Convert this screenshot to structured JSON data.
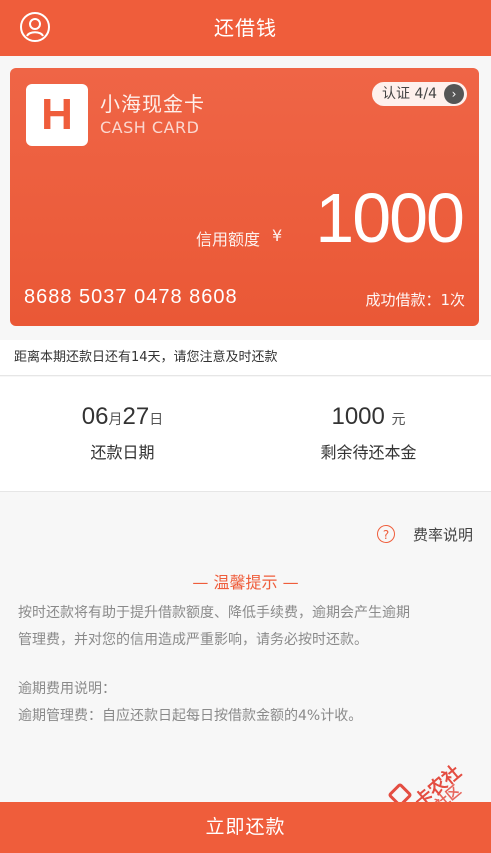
{
  "header": {
    "title": "还借钱",
    "profile_icon": "user-icon"
  },
  "card": {
    "logo_letter": "H",
    "name": "小海现金卡",
    "sub": "CASH CARD",
    "auth_label": "认证",
    "auth_progress": "4/4",
    "limit_label": "信用额度",
    "currency": "¥",
    "limit_value": "1000",
    "card_number": "8688 5037 0478 8608",
    "success_loans": "成功借款：1次"
  },
  "notice": "距离本期还款日还有14天，请您注意及时还款",
  "stats": {
    "due_month": "06",
    "month_unit": "月",
    "due_day": "27",
    "day_unit": "日",
    "due_label": "还款日期",
    "principal_value": "1000",
    "principal_unit": "元",
    "principal_label": "剩余待还本金"
  },
  "rate_link": "费率说明",
  "tip": {
    "title": "— 温馨提示 —",
    "line1": "按时还款将有助于提升借款额度、降低手续费，逾期会产生逾期",
    "line2": "管理费，并对您的信用造成严重影响，请务必按时还款。",
    "overdue_title": "逾期费用说明：",
    "overdue_text": "逾期管理费：自应还款日起每日按借款金额的4%计收。"
  },
  "footer_button": "立即还款",
  "watermark": {
    "line1": "卡农社区",
    "line2": "卡农社区"
  },
  "colors": {
    "accent": "#ef5d3b",
    "muted_text": "#8a8a8a"
  }
}
